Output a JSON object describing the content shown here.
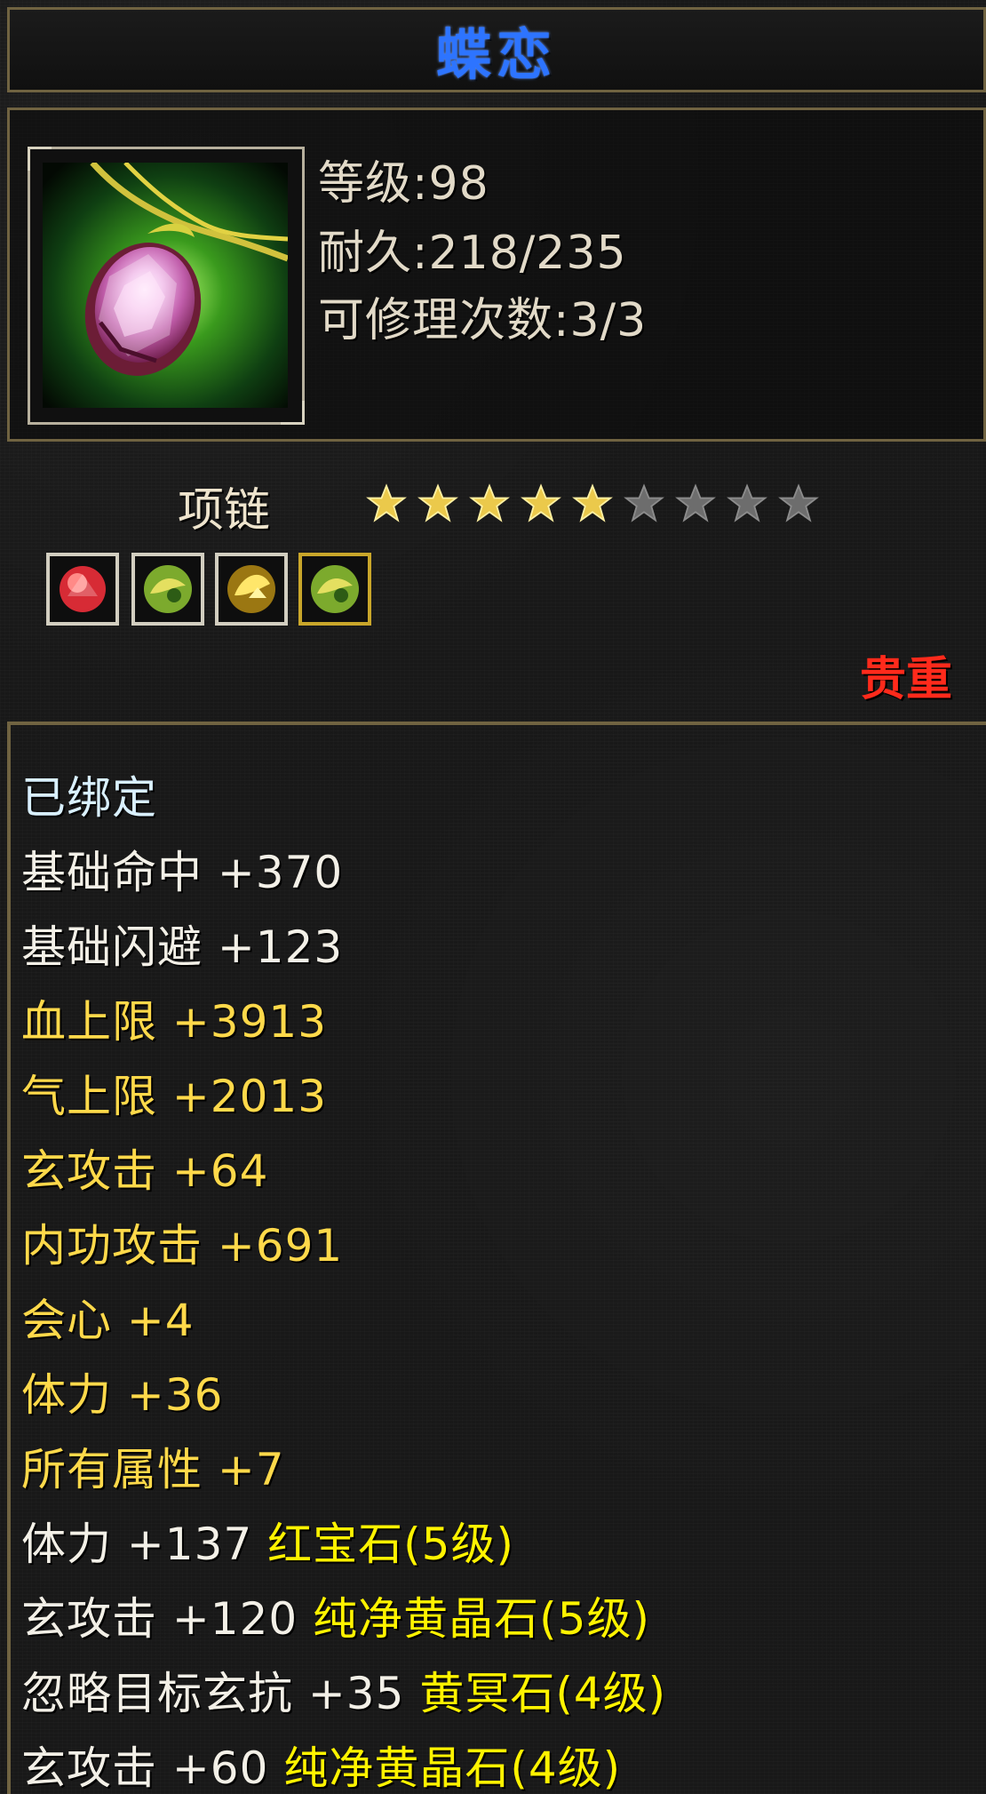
{
  "item": {
    "name": "蝶恋",
    "level": "等级:98",
    "durability": "耐久:218/235",
    "repair": "可修理次数:3/3",
    "type": "项链",
    "rarity": "贵重",
    "rating": 5,
    "rating_max": 9
  },
  "gems": [
    {
      "name": "red-gem",
      "color": "#d72b35"
    },
    {
      "name": "green-gem",
      "color": "#7caa2d"
    },
    {
      "name": "yellow-gem",
      "color": "#e2c235"
    },
    {
      "name": "green-gem",
      "color": "#7caa2d"
    }
  ],
  "attributes": {
    "bound": "已绑定",
    "hit": "基础命中 +370",
    "dodge": "基础闪避 +123",
    "hp": "血上限 +3913",
    "qi": "气上限 +2013",
    "xuan_attack": "玄攻击 +64",
    "internal_attack": "内功攻击 +691",
    "crit": "会心 +4",
    "stamina": "体力 +36",
    "all_attributes": "所有属性 +7"
  },
  "gem_bonuses": [
    {
      "stat": "体力 +137",
      "gem": "红宝石(5级)"
    },
    {
      "stat": "玄攻击 +120",
      "gem": "纯净黄晶石(5级)"
    },
    {
      "stat": "忽略目标玄抗 +35",
      "gem": "黄冥石(4级)"
    },
    {
      "stat": "玄攻击 +60",
      "gem": "纯净黄晶石(4级)"
    }
  ],
  "colors": {
    "title": "#2d74ff",
    "rarity": "#ff2a1b",
    "white_text": "#f3f0e7",
    "yellow_text": "#ffd94a",
    "gem_text": "#fff300",
    "frame": "#706341"
  }
}
